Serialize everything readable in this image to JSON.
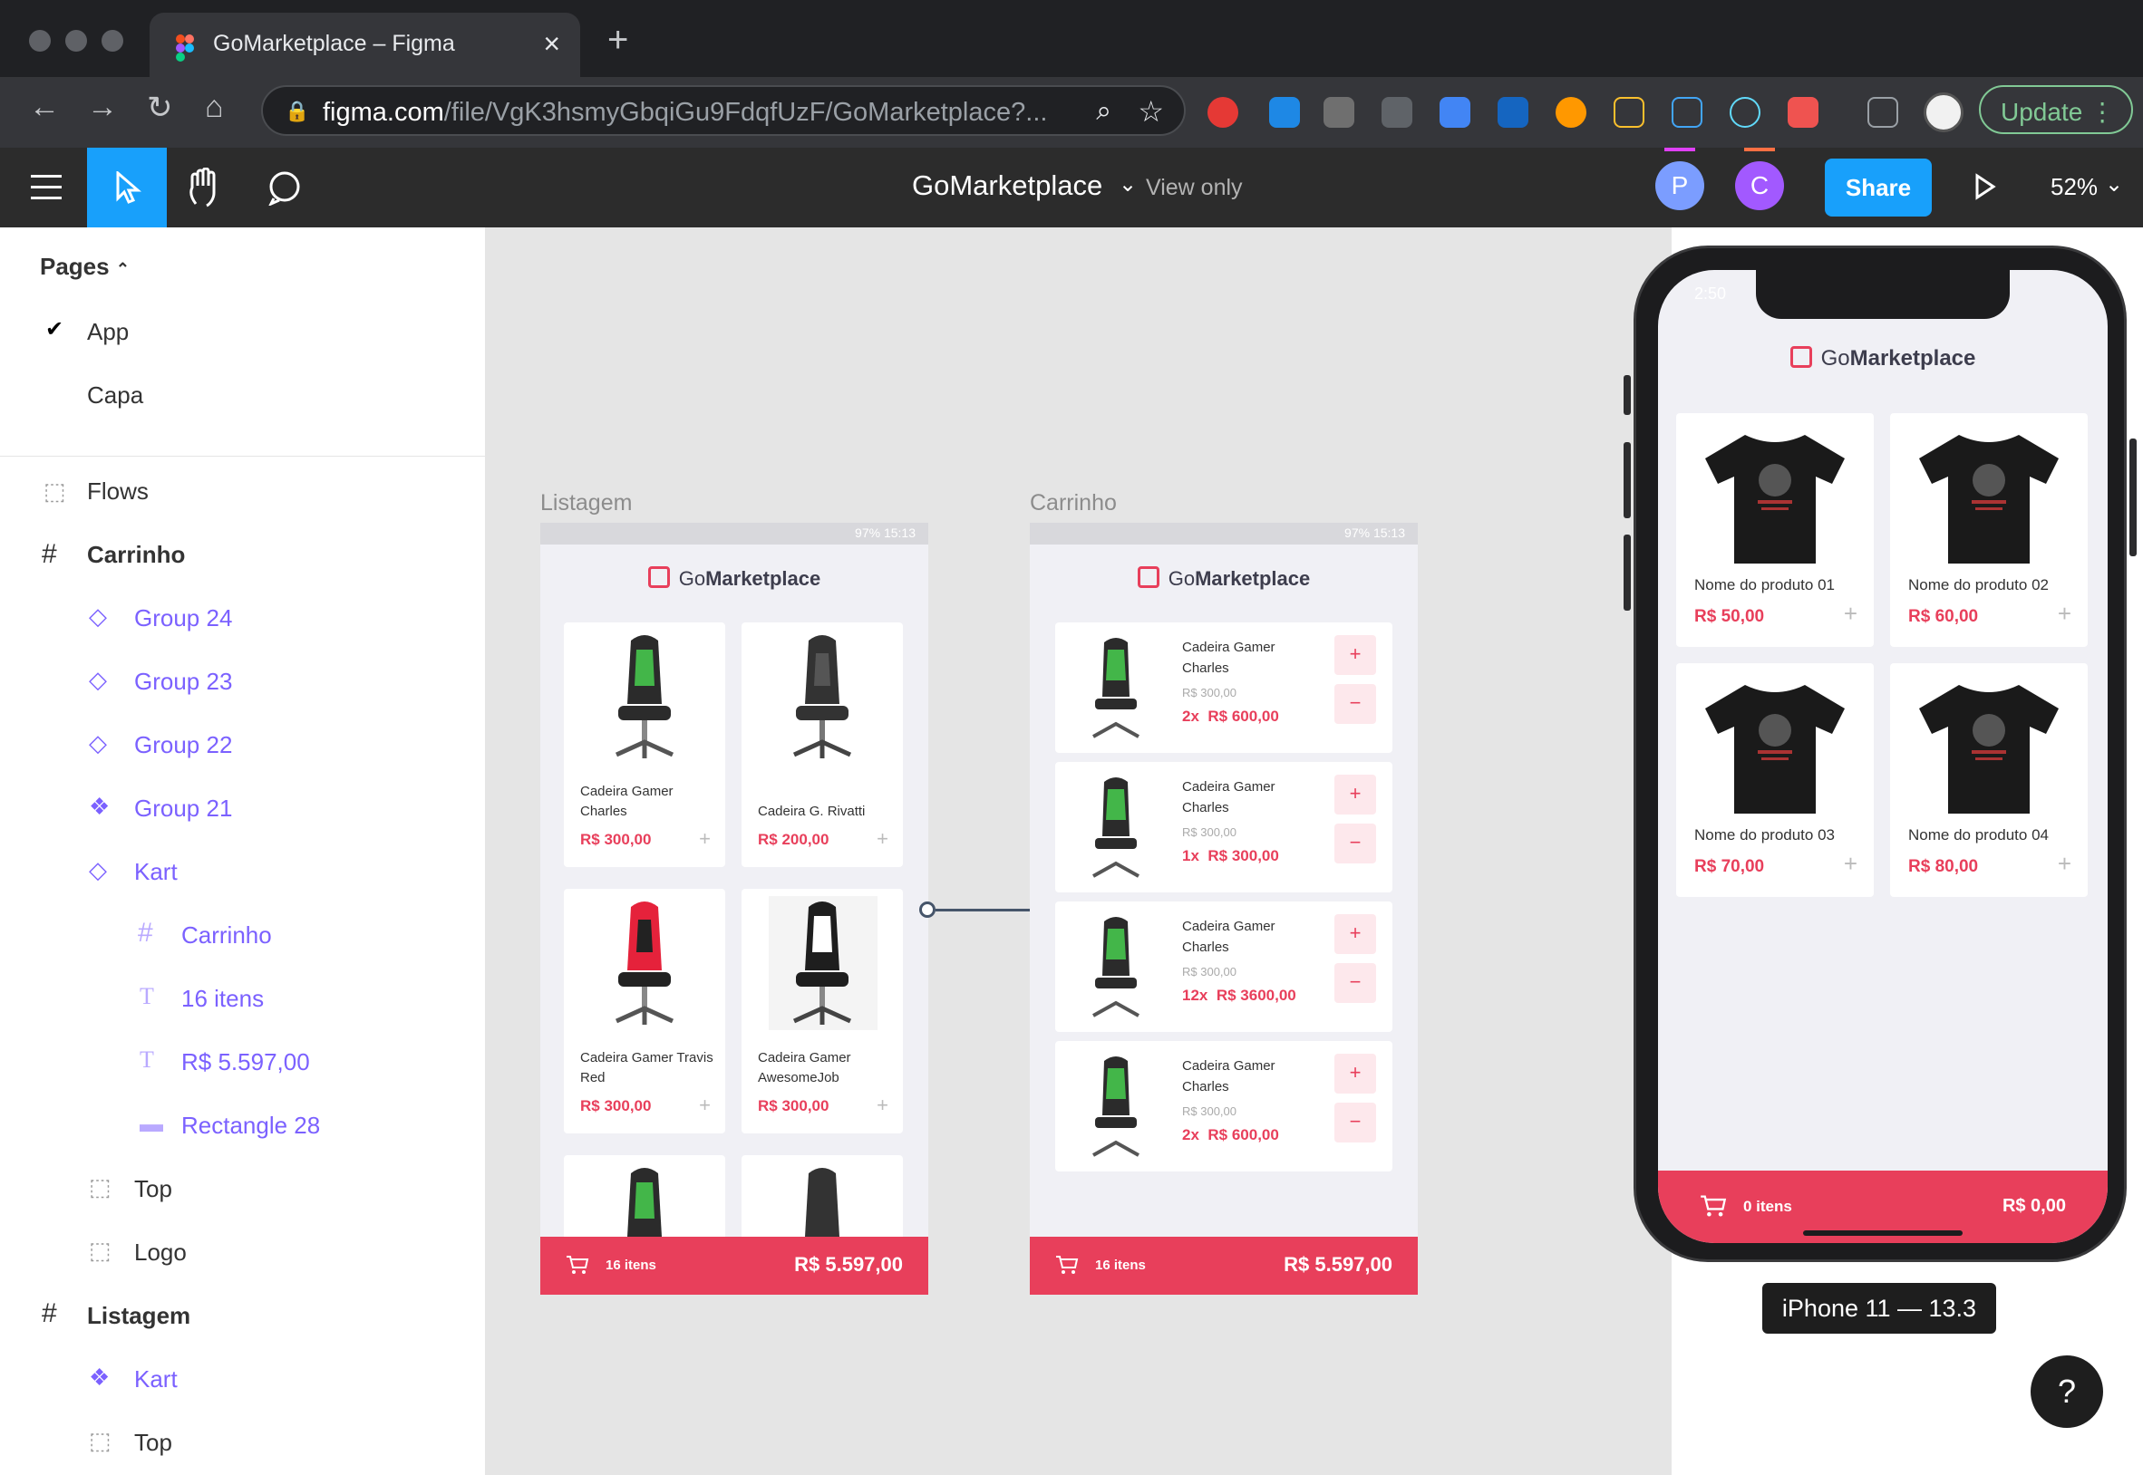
{
  "browser": {
    "tab_title": "GoMarketplace – Figma",
    "url_host": "figma.com",
    "url_path": "/file/VgK3hsmyGbqiGu9FdqfUzF/GoMarketplace?...",
    "update_label": "Update",
    "new_tab": "+",
    "close": "×"
  },
  "figma": {
    "file_title": "GoMarketplace",
    "view_mode": "View only",
    "avatars": [
      "P",
      "C"
    ],
    "share_label": "Share",
    "zoom": "52%"
  },
  "layers": {
    "pages_title": "Pages",
    "pages": [
      "App",
      "Capa"
    ],
    "items": [
      {
        "label": "Flows"
      },
      {
        "label": "Carrinho"
      },
      {
        "label": "Group 24"
      },
      {
        "label": "Group 23"
      },
      {
        "label": "Group 22"
      },
      {
        "label": "Group 21"
      },
      {
        "label": "Kart"
      },
      {
        "label": "Carrinho"
      },
      {
        "label": "16 itens"
      },
      {
        "label": "R$ 5.597,00"
      },
      {
        "label": "Rectangle 28"
      },
      {
        "label": "Top"
      },
      {
        "label": "Logo"
      },
      {
        "label": "Listagem"
      },
      {
        "label": "Kart"
      },
      {
        "label": "Top"
      }
    ]
  },
  "listagem": {
    "frame_label": "Listagem",
    "status": "97% 15:13",
    "logo_prefix": "Go",
    "logo_bold": "Marketplace",
    "products": [
      {
        "name": "Cadeira Gamer Charles",
        "price": "R$ 300,00"
      },
      {
        "name": "Cadeira G. Rivatti",
        "price": "R$ 200,00"
      },
      {
        "name": "Cadeira Gamer Travis Red",
        "price": "R$ 300,00"
      },
      {
        "name": "Cadeira Gamer AwesomeJob",
        "price": "R$ 300,00"
      }
    ],
    "items_count": "16 itens",
    "total": "R$ 5.597,00"
  },
  "carrinho": {
    "frame_label": "Carrinho",
    "status": "97% 15:13",
    "logo_prefix": "Go",
    "logo_bold": "Marketplace",
    "rows": [
      {
        "name": "Cadeira Gamer Charles",
        "unit": "R$ 300,00",
        "qty": "2x",
        "sub": "R$ 600,00"
      },
      {
        "name": "Cadeira Gamer Charles",
        "unit": "R$ 300,00",
        "qty": "1x",
        "sub": "R$ 300,00"
      },
      {
        "name": "Cadeira Gamer Charles",
        "unit": "R$ 300,00",
        "qty": "12x",
        "sub": "R$ 3600,00"
      },
      {
        "name": "Cadeira Gamer Charles",
        "unit": "R$ 300,00",
        "qty": "2x",
        "sub": "R$ 600,00"
      }
    ],
    "items_count": "16 itens",
    "total": "R$ 5.597,00"
  },
  "prototype": {
    "time": "2:50",
    "logo_prefix": "Go",
    "logo_bold": "Marketplace",
    "products": [
      {
        "name": "Nome do produto 01",
        "price": "R$ 50,00"
      },
      {
        "name": "Nome do produto 02",
        "price": "R$ 60,00"
      },
      {
        "name": "Nome do produto 03",
        "price": "R$ 70,00"
      },
      {
        "name": "Nome do produto 04",
        "price": "R$ 80,00"
      }
    ],
    "items_count": "0 itens",
    "total": "R$ 0,00",
    "device_label": "iPhone 11 — 13.3",
    "help": "?"
  },
  "colors": {
    "accent": "#e83f5b",
    "figma_blue": "#18a0fb",
    "layer_purple": "#7b61ff"
  }
}
